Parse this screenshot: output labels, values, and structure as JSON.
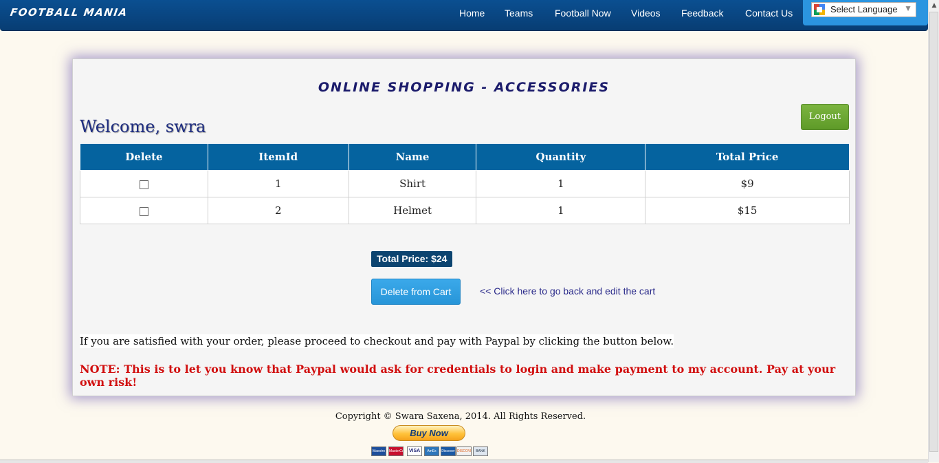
{
  "brand": "FOOTBALL MANIA",
  "nav": {
    "items": [
      "Home",
      "Teams",
      "Football Now",
      "Videos",
      "Feedback",
      "Contact Us"
    ]
  },
  "language": {
    "selected": "Select Language",
    "icon": "google-translate-icon"
  },
  "page": {
    "title": "ONLINE SHOPPING - ACCESSORIES",
    "logout_label": "Logout",
    "welcome": "Welcome, swra"
  },
  "cart": {
    "headers": [
      "Delete",
      "ItemId",
      "Name",
      "Quantity",
      "Total Price"
    ],
    "rows": [
      {
        "item_id": "1",
        "name": "Shirt",
        "quantity": "1",
        "total": "$9",
        "delete_checked": false
      },
      {
        "item_id": "2",
        "name": "Helmet",
        "quantity": "1",
        "total": "$15",
        "delete_checked": false
      }
    ]
  },
  "summary": {
    "total_label": "Total Price: $24",
    "delete_button": "Delete from Cart",
    "back_link": "<< Click here to go back and edit the cart"
  },
  "checkout": {
    "satisfied_text": "If you are satisfied with your order, please proceed to checkout and pay with Paypal by clicking the button below.",
    "note": "NOTE: This is to let you know that Paypal would ask for credentials to login and make payment to my account. Pay at your own risk!"
  },
  "footer": {
    "copyright": "Copyright © Swara Saxena, 2014. All Rights Reserved.",
    "buy_now": "Buy Now",
    "card_logos": [
      "Maestro",
      "MasterCard",
      "VISA",
      "AmEx",
      "Discover",
      "DISCOVER",
      "BANK"
    ]
  },
  "colors": {
    "navbar": "#0a4f91",
    "table_header": "#05639f",
    "logout": "#6aa832",
    "delete_button": "#2f9fe2",
    "note": "#d10f0f",
    "welcome": "#1d2c80"
  }
}
